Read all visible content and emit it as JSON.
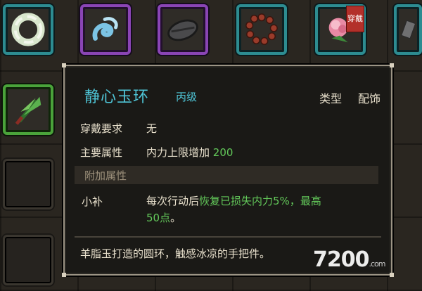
{
  "inventory": {
    "top_row": [
      {
        "icon": "jade-ring-icon"
      },
      {
        "icon": "blue-swirl-icon"
      },
      {
        "icon": "dark-bowl-icon"
      },
      {
        "icon": "prayer-beads-icon"
      },
      {
        "icon": "pink-flower-icon",
        "badge": "穿戴"
      },
      {
        "icon": "grey-item-icon"
      }
    ],
    "side": [
      {
        "icon": "herb-bundle-icon"
      }
    ]
  },
  "tooltip": {
    "name": "静心玉环",
    "grade": "丙级",
    "type_label": "类型",
    "type_value": "配饰",
    "requirement_label": "穿戴要求",
    "requirement_value": "无",
    "main_attr_label": "主要属性",
    "main_attr_text": "内力上限增加",
    "main_attr_value": "200",
    "extra_header": "附加属性",
    "bonus_label": "小补",
    "bonus_prefix": "每次行动后",
    "bonus_highlight": "恢复已损失内力5%，最高",
    "bonus_highlight_2": "50点",
    "bonus_suffix": "。",
    "description": "羊脂玉打造的圆环，触感冰凉的手把件。"
  },
  "watermark": {
    "text": "7200",
    "suffix": ".com"
  },
  "colors": {
    "item_name": "#4fc6d8",
    "positive_value": "#63c95a",
    "slot_teal": "#2d8c91",
    "slot_purple": "#8a45b5",
    "slot_green": "#4aa33a"
  }
}
